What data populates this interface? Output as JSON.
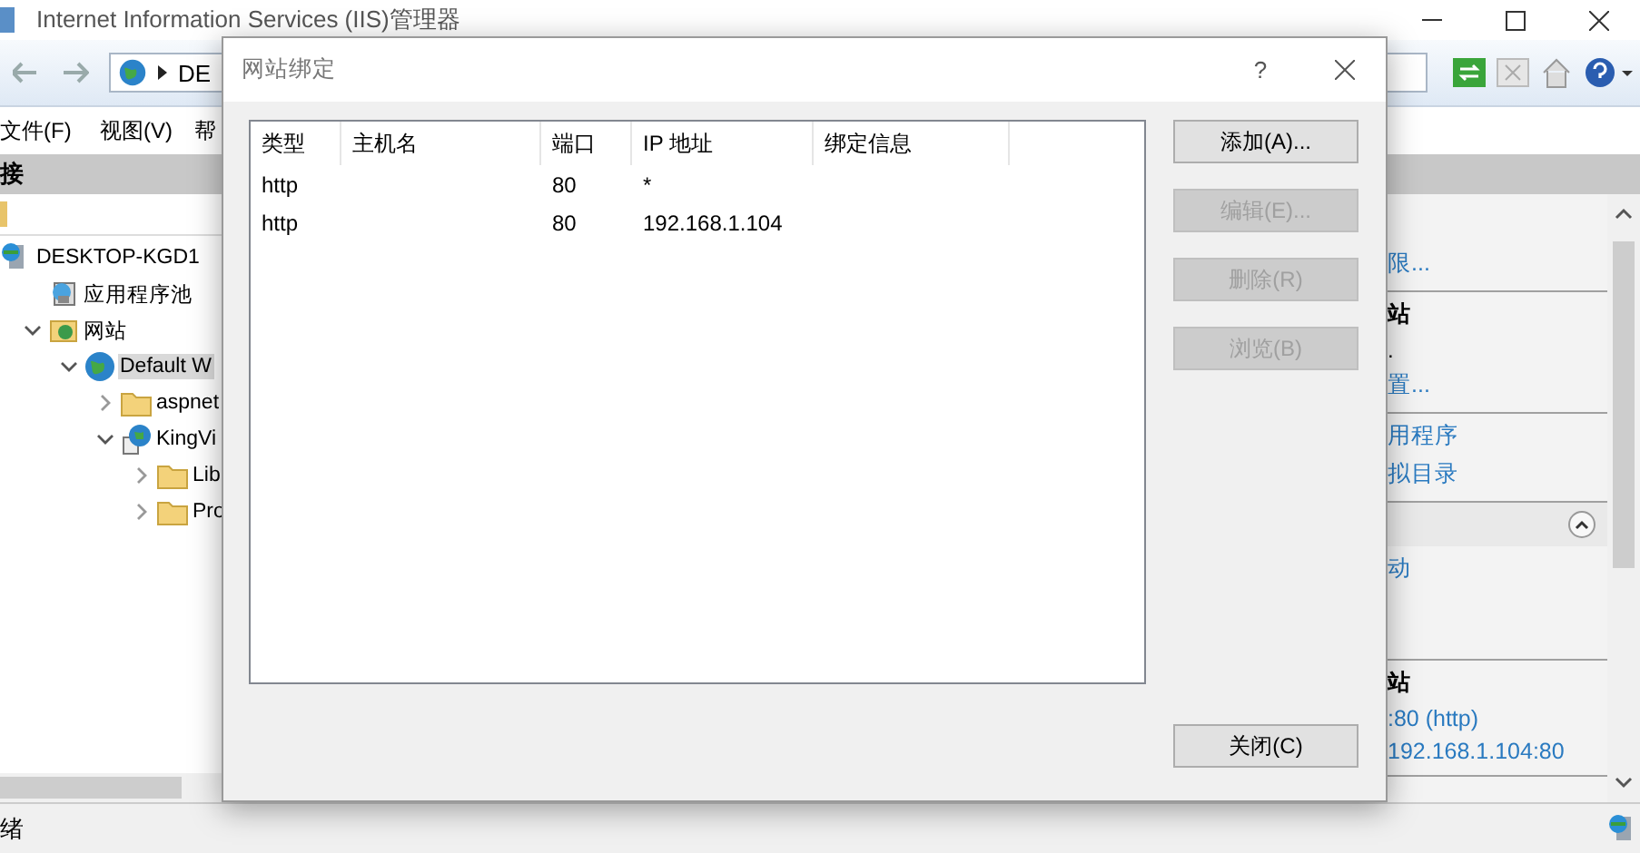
{
  "window": {
    "title": "Internet Information Services (IIS)管理器"
  },
  "address_bar": {
    "path": "DE"
  },
  "menu": [
    "文件(F)",
    "视图(V)",
    "帮"
  ],
  "connections": {
    "header": "接",
    "tree": [
      {
        "label": "DESKTOP-KGD1",
        "kind": "server",
        "selected": false,
        "children": [
          {
            "label": "应用程序池",
            "kind": "pool",
            "selected": false
          },
          {
            "label": "网站",
            "kind": "sites",
            "selected": false,
            "expanded": true,
            "children": [
              {
                "label": "Default W",
                "kind": "globe",
                "selected": true,
                "expanded": true,
                "children": [
                  {
                    "label": "aspnet",
                    "kind": "folder",
                    "selected": false,
                    "expanded": false
                  },
                  {
                    "label": "KingVi",
                    "kind": "app",
                    "selected": false,
                    "expanded": true,
                    "children": [
                      {
                        "label": "Lib",
                        "kind": "folder",
                        "selected": false,
                        "expanded": false
                      },
                      {
                        "label": "Pro",
                        "kind": "folder",
                        "selected": false,
                        "expanded": false
                      }
                    ]
                  }
                ]
              }
            ]
          }
        ]
      }
    ]
  },
  "actions": {
    "groups": [
      {
        "collapsible": false,
        "items": [
          {
            "kind": "link",
            "text": "限..."
          }
        ]
      },
      {
        "collapsible": false,
        "items": [
          {
            "kind": "heading",
            "text": "站"
          },
          {
            "kind": "text",
            "text": "."
          },
          {
            "kind": "link",
            "text": "置..."
          }
        ]
      },
      {
        "collapsible": false,
        "items": [
          {
            "kind": "link",
            "text": "用程序"
          },
          {
            "kind": "link",
            "text": "拟目录"
          }
        ]
      },
      {
        "collapsible": true,
        "items": [
          {
            "kind": "link",
            "text": "动"
          }
        ]
      },
      {
        "collapsible": false,
        "items": [
          {
            "kind": "heading",
            "text": "站"
          },
          {
            "kind": "link",
            "text": ":80 (http)"
          },
          {
            "kind": "link",
            "text": "192.168.1.104:80"
          }
        ]
      }
    ]
  },
  "status_bar": {
    "text": "绪"
  },
  "dialog": {
    "title": "网站绑定",
    "help": "?",
    "columns": [
      "类型",
      "主机名",
      "端口",
      "IP 地址",
      "绑定信息"
    ],
    "rows": [
      {
        "type": "http",
        "port": "80",
        "ip": "*"
      },
      {
        "type": "http",
        "port": "80",
        "ip": "192.168.1.104"
      }
    ],
    "buttons": [
      {
        "label": "添加(A)...",
        "disabled": false
      },
      {
        "label": "编辑(E)...",
        "disabled": true
      },
      {
        "label": "删除(R)",
        "disabled": true
      },
      {
        "label": "浏览(B)",
        "disabled": true
      }
    ],
    "close_button": "关闭(C)"
  }
}
